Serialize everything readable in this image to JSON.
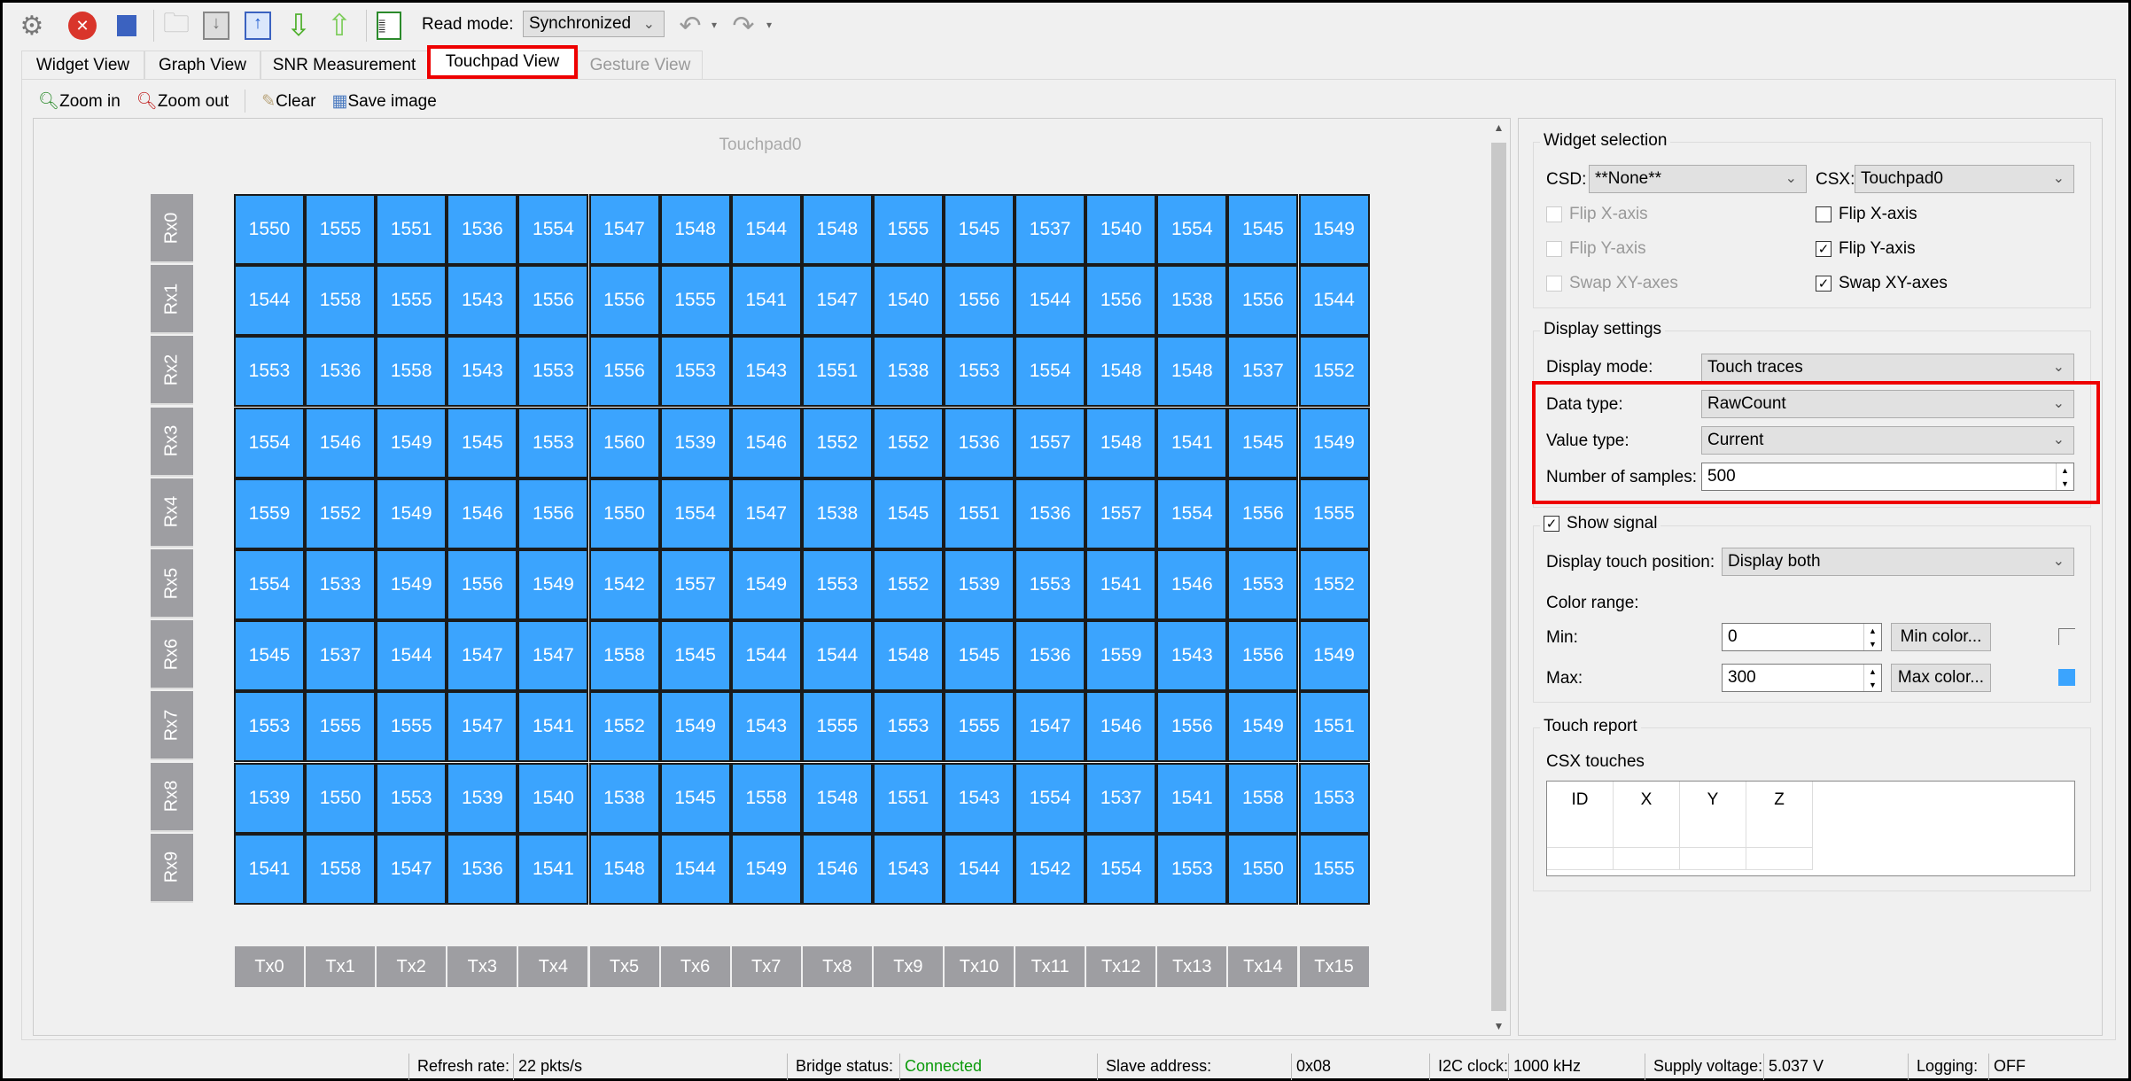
{
  "toolbar": {
    "icons": [
      "gear-icon",
      "disconnect-icon",
      "stop-icon",
      "open-folder-icon",
      "import-icon",
      "export-icon",
      "download-icon",
      "upload-icon",
      "log-icon",
      "undo-icon",
      "redo-icon"
    ],
    "read_mode_label": "Read mode:",
    "read_mode_value": "Synchronized"
  },
  "tabs": [
    {
      "label": "Widget View"
    },
    {
      "label": "Graph View"
    },
    {
      "label": "SNR Measurement"
    },
    {
      "label": "Touchpad View",
      "active": true
    },
    {
      "label": "Gesture View",
      "disabled": true
    }
  ],
  "subtoolbar": {
    "zoom_in": "Zoom in",
    "zoom_out": "Zoom out",
    "clear": "Clear",
    "save_image": "Save image"
  },
  "touchpad": {
    "title": "Touchpad0",
    "cell_color": "#3ba4fe",
    "rx_labels": [
      "Rx0",
      "Rx1",
      "Rx2",
      "Rx3",
      "Rx4",
      "Rx5",
      "Rx6",
      "Rx7",
      "Rx8",
      "Rx9"
    ],
    "tx_labels": [
      "Tx0",
      "Tx1",
      "Tx2",
      "Tx3",
      "Tx4",
      "Tx5",
      "Tx6",
      "Tx7",
      "Tx8",
      "Tx9",
      "Tx10",
      "Tx11",
      "Tx12",
      "Tx13",
      "Tx14",
      "Tx15"
    ],
    "values": [
      [
        1550,
        1555,
        1551,
        1536,
        1554,
        1547,
        1548,
        1544,
        1548,
        1555,
        1545,
        1537,
        1540,
        1554,
        1545,
        1549
      ],
      [
        1544,
        1558,
        1555,
        1543,
        1556,
        1556,
        1555,
        1541,
        1547,
        1540,
        1556,
        1544,
        1556,
        1538,
        1556,
        1544
      ],
      [
        1553,
        1536,
        1558,
        1543,
        1553,
        1556,
        1553,
        1543,
        1551,
        1538,
        1553,
        1554,
        1548,
        1548,
        1537,
        1552
      ],
      [
        1554,
        1546,
        1549,
        1545,
        1553,
        1560,
        1539,
        1546,
        1552,
        1552,
        1536,
        1557,
        1548,
        1541,
        1545,
        1549
      ],
      [
        1559,
        1552,
        1549,
        1546,
        1556,
        1550,
        1554,
        1547,
        1538,
        1545,
        1551,
        1536,
        1557,
        1554,
        1556,
        1555
      ],
      [
        1554,
        1533,
        1549,
        1556,
        1549,
        1542,
        1557,
        1549,
        1553,
        1552,
        1539,
        1553,
        1541,
        1546,
        1553,
        1552
      ],
      [
        1545,
        1537,
        1544,
        1547,
        1547,
        1558,
        1545,
        1544,
        1544,
        1548,
        1545,
        1536,
        1559,
        1543,
        1556,
        1549
      ],
      [
        1553,
        1555,
        1555,
        1547,
        1541,
        1552,
        1549,
        1543,
        1555,
        1553,
        1555,
        1547,
        1546,
        1556,
        1549,
        1551
      ],
      [
        1539,
        1550,
        1553,
        1539,
        1540,
        1538,
        1545,
        1558,
        1548,
        1551,
        1543,
        1554,
        1537,
        1541,
        1558,
        1553
      ],
      [
        1541,
        1558,
        1547,
        1536,
        1541,
        1548,
        1544,
        1549,
        1546,
        1543,
        1544,
        1542,
        1554,
        1553,
        1550,
        1555
      ]
    ]
  },
  "panel": {
    "widget_selection": {
      "title": "Widget selection",
      "csd_label": "CSD:",
      "csd_value": "**None**",
      "csx_label": "CSX:",
      "csx_value": "Touchpad0",
      "csd_checks": [
        {
          "label": "Flip X-axis",
          "checked": false
        },
        {
          "label": "Flip Y-axis",
          "checked": false
        },
        {
          "label": "Swap XY-axes",
          "checked": false
        }
      ],
      "csx_checks": [
        {
          "label": "Flip X-axis",
          "checked": false
        },
        {
          "label": "Flip Y-axis",
          "checked": true
        },
        {
          "label": "Swap XY-axes",
          "checked": true
        }
      ]
    },
    "display": {
      "title": "Display settings",
      "mode_label": "Display mode:",
      "mode_value": "Touch traces",
      "data_type_label": "Data type:",
      "data_type_value": "RawCount",
      "value_type_label": "Value type:",
      "value_type_value": "Current",
      "samples_label": "Number of samples:",
      "samples_value": "500"
    },
    "signal": {
      "title": "Show signal",
      "checked": true,
      "position_label": "Display touch position:",
      "position_value": "Display both",
      "color_range_label": "Color range:",
      "min_label": "Min:",
      "min_value": "0",
      "min_button": "Min color...",
      "max_label": "Max:",
      "max_value": "300",
      "max_button": "Max color...",
      "max_color": "#3ba4fe"
    },
    "touch_report": {
      "title": "Touch report",
      "csx_touches_label": "CSX touches",
      "columns": [
        "ID",
        "X",
        "Y",
        "Z"
      ]
    }
  },
  "status": {
    "refresh_label": "Refresh rate:",
    "refresh_value": "22 pkts/s",
    "bridge_label": "Bridge status:",
    "bridge_value": "Connected",
    "bridge_color": "#0a9a0a",
    "slave_label": "Slave address:",
    "slave_value": "0x08",
    "i2c_label": "I2C clock:",
    "i2c_value": "1000 kHz",
    "supply_label": "Supply voltage:",
    "supply_value": "5.037 V",
    "logging_label": "Logging:",
    "logging_value": "OFF"
  }
}
